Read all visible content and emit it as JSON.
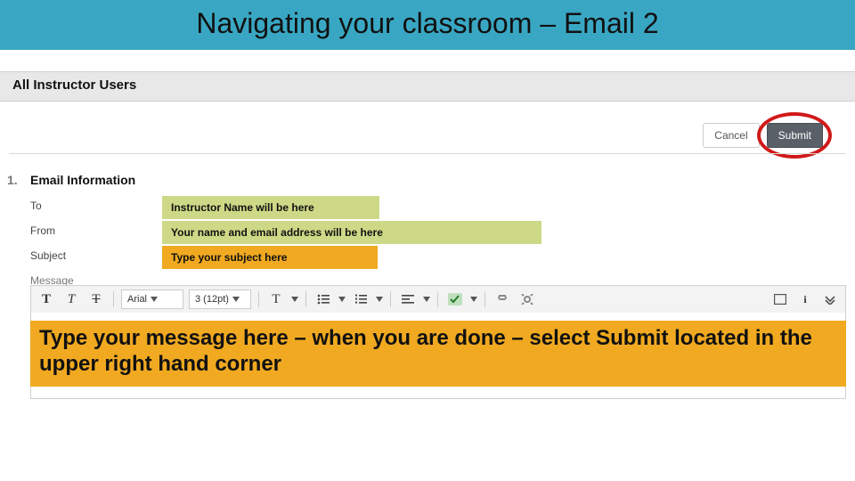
{
  "title": "Navigating your classroom – Email 2",
  "subhead": "All Instructor Users",
  "buttons": {
    "cancel": "Cancel",
    "submit": "Submit"
  },
  "section": {
    "step_number": "1.",
    "title": "Email Information",
    "labels": {
      "to": "To",
      "from": "From",
      "subject": "Subject",
      "message": "Message"
    },
    "hints": {
      "to": "Instructor Name will be here",
      "from": "Your name and email address will be here",
      "subject": "Type your subject here"
    }
  },
  "toolbar": {
    "font_family": "Arial",
    "font_size": "3 (12pt)"
  },
  "message_callout": "Type your message here – when you are done – select Submit located in the upper right hand corner"
}
